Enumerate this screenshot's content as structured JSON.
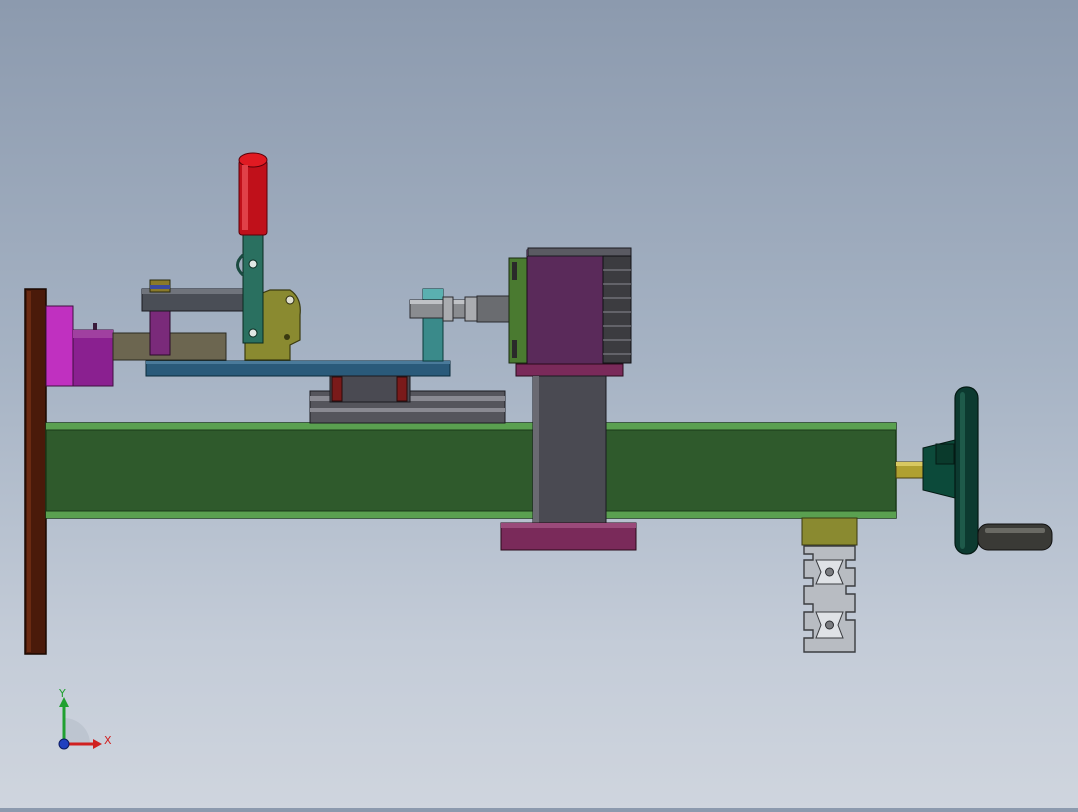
{
  "view": {
    "triad": {
      "x_label": "X",
      "y_label": "Y",
      "x_color": "#d02020",
      "y_color": "#20a030",
      "z_color": "#2040c0"
    }
  },
  "model": {
    "colors": {
      "wall_plate": "#4a1a0a",
      "main_beam": "#2f5a2c",
      "beam_edge": "#5aa050",
      "magenta_block": "#8a2090",
      "clamp_handle": "#c0101a",
      "clamp_lever": "#2a7060",
      "clamp_body": "#8a8a30",
      "base_plate": "#2a5a7a",
      "support_post": "#3a8a8a",
      "rail_block": "#7a1a1a",
      "rail": "#55555c",
      "motor_body": "#5a2a5a",
      "motor_fins": "#3c3c40",
      "column": "#4a4a52",
      "column_flange": "#7a2a5a",
      "handwheel": "#0c3a30",
      "shaft": "#b0a030",
      "knob": "#3a3a36",
      "profile_bracket": "#8a8a30",
      "profile": "#9a9ca2"
    }
  }
}
